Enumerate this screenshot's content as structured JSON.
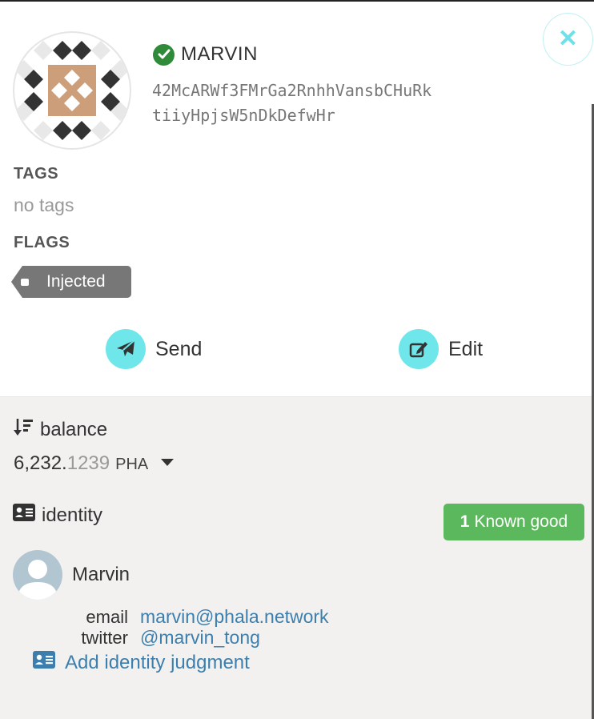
{
  "window": {
    "close_icon": "close-icon",
    "close_glyph": "✕"
  },
  "account": {
    "name": "MARVIN",
    "verified_icon": "check-circle-icon",
    "address": "42McARWf3FMrGa2RnhhVansbCHuRktiiyHpjsW5nDkDefwHr"
  },
  "tags": {
    "label": "TAGS",
    "empty_text": "no tags"
  },
  "flags": {
    "label": "FLAGS",
    "items": [
      "Injected"
    ]
  },
  "actions": {
    "send_label": "Send",
    "send_icon": "paper-plane-icon",
    "edit_label": "Edit",
    "edit_icon": "edit-icon"
  },
  "balance": {
    "label": "balance",
    "icon": "sort-amount-down-icon",
    "integer": "6,232.",
    "decimal": "1239",
    "unit": "PHA"
  },
  "identity": {
    "label": "icon-less",
    "heading": "identity",
    "judgement_count": "1",
    "judgement_text": "Known good",
    "display_name": "Marvin",
    "fields": [
      {
        "label": "email",
        "value": "marvin@phala.network"
      },
      {
        "label": "twitter",
        "value": "@marvin_tong"
      }
    ],
    "add_judgment": "Add identity judgment"
  },
  "colors": {
    "accent": "#6ee6ea",
    "success": "#5cb85c",
    "link": "#3c7fae",
    "verified": "#2f8a3a",
    "flag_bg": "#777777"
  }
}
